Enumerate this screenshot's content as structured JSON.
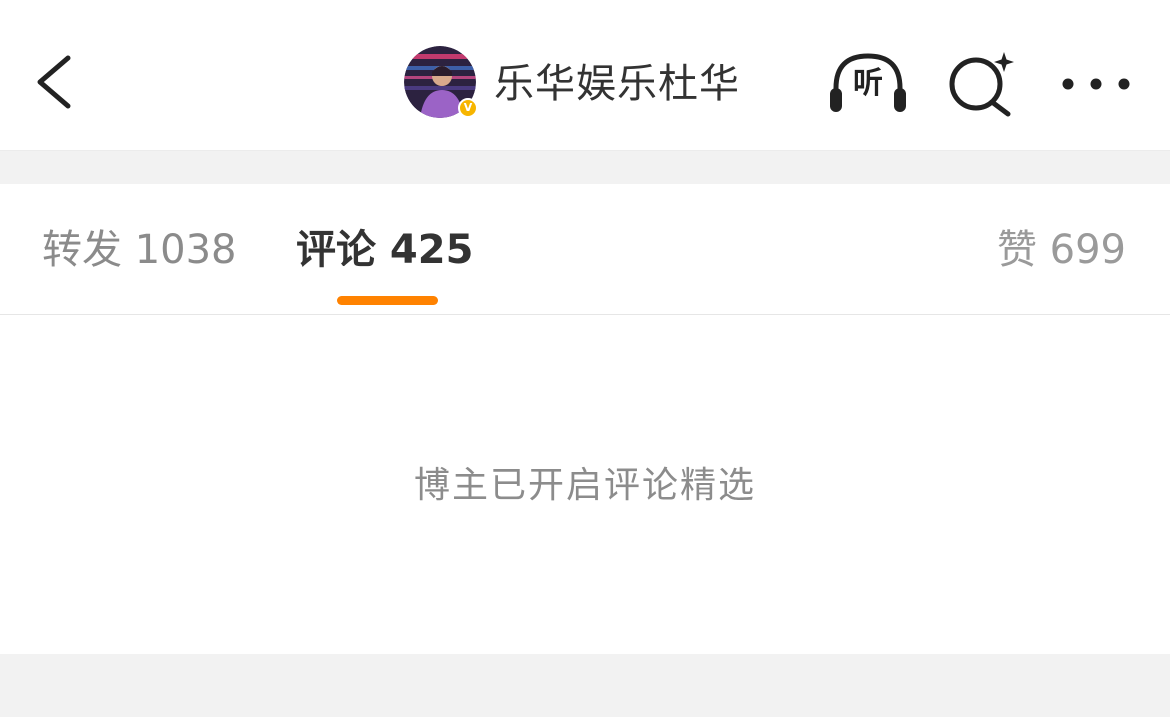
{
  "header": {
    "username": "乐华娱乐杜华",
    "verified_badge": "V",
    "listen_label": "听",
    "icons": {
      "back": "chevron-left-icon",
      "listen": "headphones-icon",
      "search": "search-sparkle-icon",
      "more": "more-dots-icon"
    }
  },
  "tabs": {
    "repost": "转发 1038",
    "comment": "评论 425",
    "like": "赞 699",
    "active": "comment"
  },
  "content": {
    "empty_message": "博主已开启评论精选"
  },
  "colors": {
    "accent": "#ff8200",
    "verified": "#f7b500",
    "text_primary": "#333333",
    "text_secondary": "#8c8c8c",
    "background": "#f2f2f2"
  }
}
